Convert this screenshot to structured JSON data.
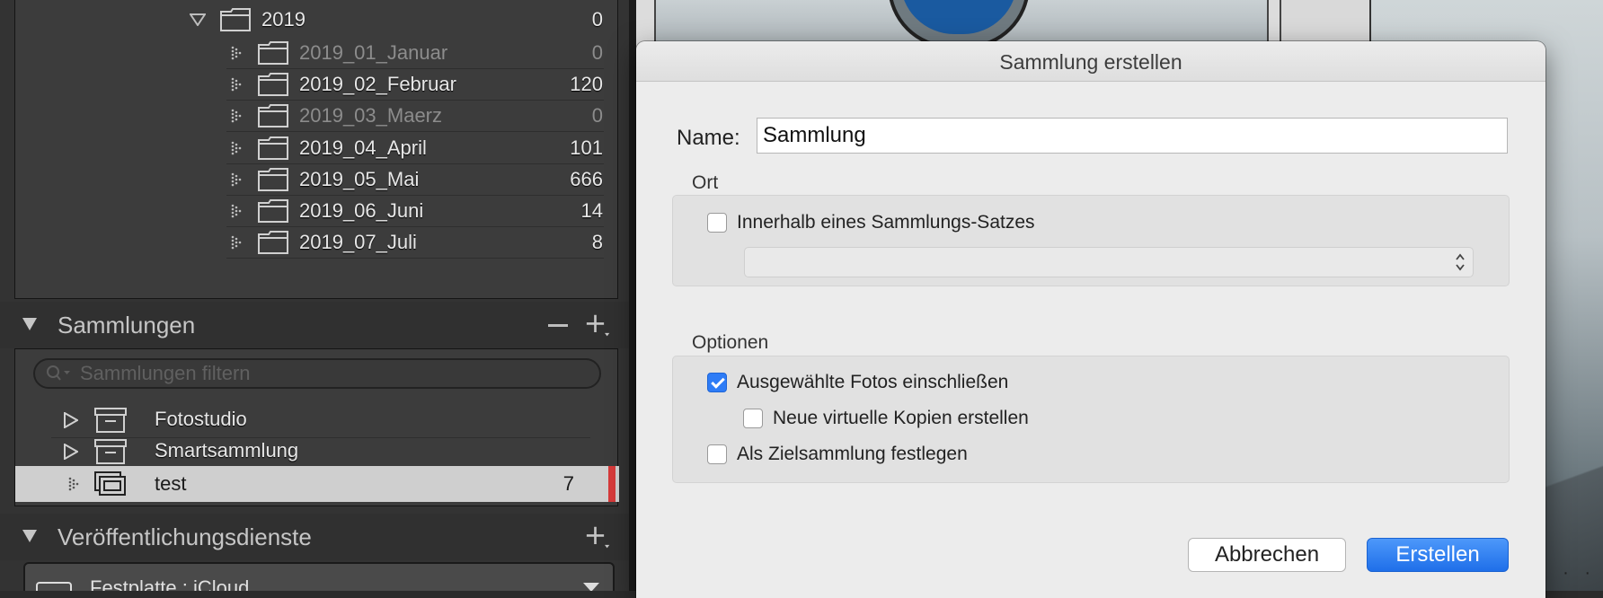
{
  "folders": {
    "year": {
      "label": "2019",
      "count": "0"
    },
    "items": [
      {
        "label": "2019_01_Januar",
        "count": "0",
        "dim": true
      },
      {
        "label": "2019_02_Februar",
        "count": "120",
        "dim": false
      },
      {
        "label": "2019_03_Maerz",
        "count": "0",
        "dim": true
      },
      {
        "label": "2019_04_April",
        "count": "101",
        "dim": false
      },
      {
        "label": "2019_05_Mai",
        "count": "666",
        "dim": false
      },
      {
        "label": "2019_06_Juni",
        "count": "14",
        "dim": false
      },
      {
        "label": "2019_07_Juli",
        "count": "8",
        "dim": false
      }
    ]
  },
  "collections": {
    "title": "Sammlungen",
    "search_placeholder": "Sammlungen filtern",
    "items": [
      {
        "label": "Fotostudio",
        "count": ""
      },
      {
        "label": "Smartsammlung",
        "count": ""
      },
      {
        "label": "test",
        "count": "7"
      }
    ]
  },
  "publish": {
    "title": "Veröffentlichungsdienste",
    "service_label": "Festplatte : iCloud"
  },
  "dialog": {
    "title": "Sammlung erstellen",
    "name_label": "Name:",
    "name_value": "Sammlung",
    "location_label": "Ort",
    "inside_set_label": "Innerhalb eines Sammlungs-Satzes",
    "inside_set_checked": false,
    "options_label": "Optionen",
    "include_selected_label": "Ausgewählte Fotos einschließen",
    "include_selected_checked": true,
    "virtual_copies_label": "Neue virtuelle Kopien erstellen",
    "virtual_copies_checked": false,
    "target_label": "Als Zielsammlung festlegen",
    "target_checked": false,
    "cancel_label": "Abbrechen",
    "create_label": "Erstellen"
  },
  "colors": {
    "accent": "#2e7cf6",
    "selection_marker": "#d63a3a"
  }
}
